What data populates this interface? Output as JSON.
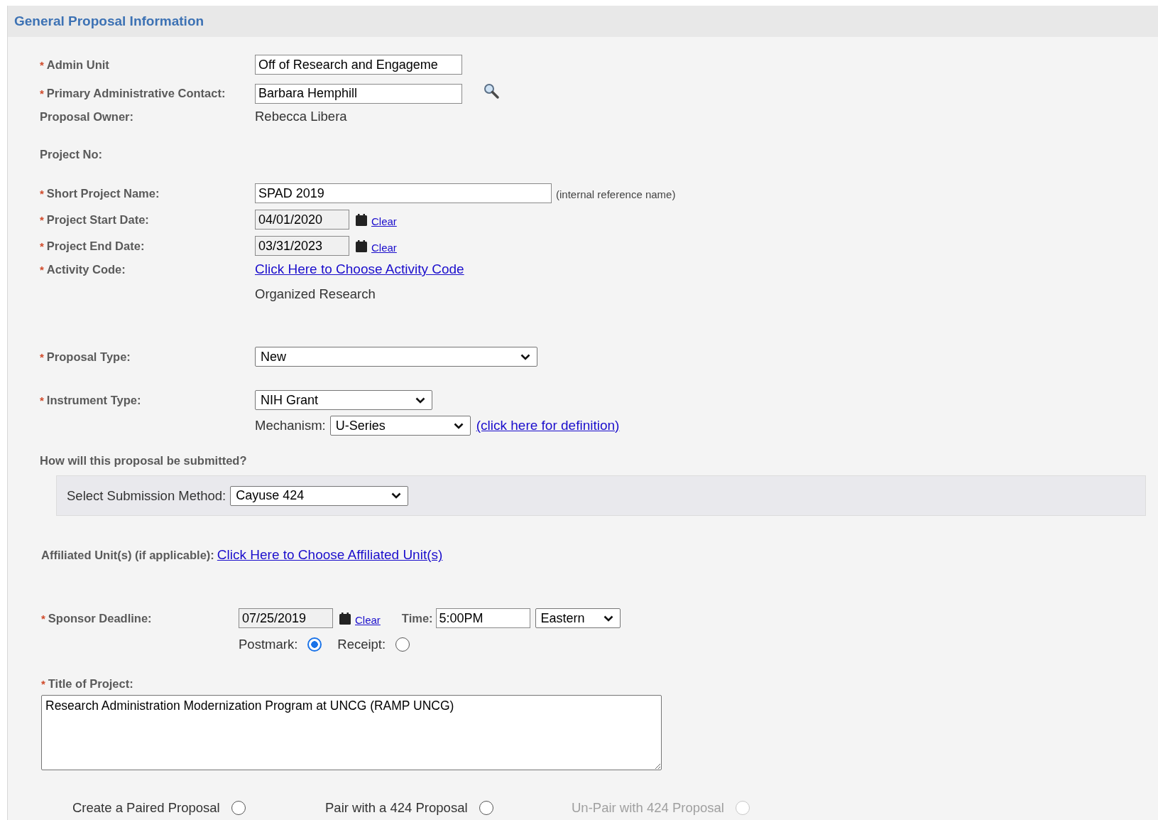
{
  "section": {
    "title": "General Proposal Information"
  },
  "required_mark": "*",
  "admin_unit": {
    "label": "Admin Unit",
    "required": true,
    "value": "Off of Research and Engageme"
  },
  "primary_contact": {
    "label": "Primary Administrative Contact:",
    "required": true,
    "value": "Barbara Hemphill"
  },
  "proposal_owner": {
    "label": "Proposal Owner:",
    "value": "Rebecca Libera"
  },
  "project_no": {
    "label": "Project No:"
  },
  "short_name": {
    "label": "Short Project Name:",
    "required": true,
    "value": "SPAD 2019",
    "hint": "(internal reference name)"
  },
  "start_date": {
    "label": "Project Start Date:",
    "required": true,
    "value": "04/01/2020",
    "clear": "Clear"
  },
  "end_date": {
    "label": "Project End Date:",
    "required": true,
    "value": "03/31/2023",
    "clear": "Clear"
  },
  "activity_code": {
    "label": "Activity Code:",
    "required": true,
    "link": "Click Here to Choose Activity Code",
    "value": "Organized Research"
  },
  "proposal_type": {
    "label": "Proposal Type:",
    "required": true,
    "value": "New"
  },
  "instrument_type": {
    "label": "Instrument Type:",
    "required": true,
    "value": "NIH Grant"
  },
  "mechanism": {
    "label": "Mechanism:",
    "value": "U-Series",
    "link": "(click here for definition)"
  },
  "submission": {
    "question": "How will this proposal be submitted?",
    "label": "Select Submission Method:",
    "value": "Cayuse 424"
  },
  "affiliated": {
    "label": "Affiliated Unit(s) (if applicable):",
    "link": "Click Here to Choose Affiliated Unit(s)"
  },
  "sponsor_deadline": {
    "label": "Sponsor Deadline:",
    "required": true,
    "date": "07/25/2019",
    "clear": "Clear",
    "time_label": "Time:",
    "time": "5:00PM",
    "zone": "Eastern",
    "options": [
      {
        "label": "Postmark:",
        "selected": true
      },
      {
        "label": "Receipt:",
        "selected": false
      }
    ]
  },
  "title_of_project": {
    "label": "Title of Project:",
    "required": true,
    "value": "Research Administration Modernization Program at UNCG (RAMP UNCG)"
  },
  "pairing": [
    {
      "label": "Create a Paired Proposal",
      "selected": false,
      "disabled": false
    },
    {
      "label": "Pair with a 424 Proposal",
      "selected": false,
      "disabled": false
    },
    {
      "label": "Un-Pair with 424 Proposal",
      "selected": false,
      "disabled": true
    }
  ]
}
